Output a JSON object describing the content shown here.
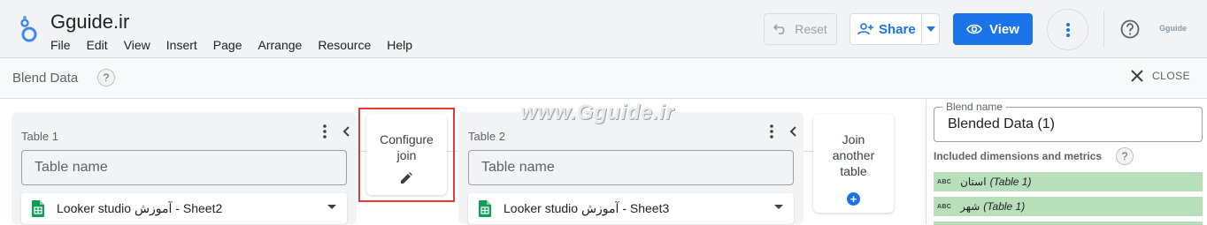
{
  "app": {
    "title": "Gguide.ir",
    "menu": [
      "File",
      "Edit",
      "View",
      "Insert",
      "Page",
      "Arrange",
      "Resource",
      "Help"
    ],
    "brand": "Gguide"
  },
  "toolbar": {
    "reset_label": "Reset",
    "share_label": "Share",
    "view_label": "View"
  },
  "blend": {
    "title": "Blend Data",
    "help_mark": "?",
    "close_label": "CLOSE"
  },
  "watermark": "www.Gguide.ir",
  "tables": [
    {
      "label": "Table 1",
      "name_placeholder": "Table name",
      "source": "Looker studio آموزش - Sheet2"
    },
    {
      "label": "Table 2",
      "name_placeholder": "Table name",
      "source": "Looker studio آموزش - Sheet3"
    }
  ],
  "join": {
    "label_line1": "Configure",
    "label_line2": "join"
  },
  "another": {
    "label_line1": "Join",
    "label_line2": "another",
    "label_line3": "table",
    "plus": "+"
  },
  "right_panel": {
    "blend_name_legend": "Blend name",
    "blend_name_value": "Blended Data (1)",
    "dims_title": "Included dimensions and metrics",
    "dims_help": "?",
    "fields": [
      {
        "type": "ABC",
        "name": "استان",
        "table": "(Table 1)"
      },
      {
        "type": "ABC",
        "name": "شهر",
        "table": "(Table 1)"
      }
    ]
  },
  "colors": {
    "accent": "#1a73e8",
    "highlight": "#e53935",
    "field_chip": "#b7dfb9",
    "sheets_green": "#0f9d58"
  }
}
